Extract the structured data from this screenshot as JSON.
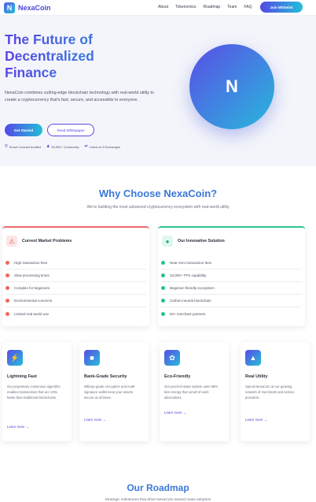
{
  "nav": {
    "logo_letter": "N",
    "brand": "NexaCoin",
    "links": [
      "About",
      "Tokenomics",
      "Roadmap",
      "Team",
      "FAQ"
    ],
    "cta": "Join Whitelist"
  },
  "hero": {
    "title": "The Future of Decentralized Finance",
    "description": "NexaCoin combines cutting-edge blockchain technology with real-world utility to create a cryptocurrency that's fast, secure, and accessible to everyone.",
    "primary_button": "Get Started",
    "secondary_button": "Read Whitepaper",
    "badges": [
      "Smart Contract Audited",
      "50,000+ Community",
      "Listed on 5 Exchanges"
    ],
    "emblem_letter": "N"
  },
  "why": {
    "title": "Why Choose NexaCoin?",
    "subtitle": "We're building the most advanced cryptocurrency ecosystem with real-world utility",
    "problems": {
      "title": "Current Market Problems",
      "items": [
        "High transaction fees",
        "Slow processing times",
        "Complex for beginners",
        "Environmental concerns",
        "Limited real-world use"
      ]
    },
    "solution": {
      "title": "Our Innovative Solution",
      "items": [
        "Near-zero transaction fees",
        "10,000+ TPS capability",
        "Beginner-friendly ecosystem",
        "Carbon-neutral blockchain",
        "50+ merchant partners"
      ]
    }
  },
  "features": [
    {
      "title": "Lightning Fast",
      "description": "Our proprietary consensus algorithm enables transactions that are 100x faster than traditional blockchains.",
      "link": "Learn more",
      "icon": "lightning-icon"
    },
    {
      "title": "Bank-Grade Security",
      "description": "Military-grade encryption and multi-signature wallet keep your assets secure at all times.",
      "link": "Learn more",
      "icon": "lock-icon"
    },
    {
      "title": "Eco-Friendly",
      "description": "Our proof-of-stake system uses 99% less energy than proof-of-work alternatives.",
      "link": "Learn more",
      "icon": "leaf-icon"
    },
    {
      "title": "Real Utility",
      "description": "Spend NexaCoin at our growing network of merchants and service providers.",
      "link": "Learn more",
      "icon": "utility-icon"
    }
  ],
  "roadmap": {
    "title": "Our Roadmap",
    "subtitle": "Strategic milestones that drive NexaCoin toward mass adoption"
  }
}
